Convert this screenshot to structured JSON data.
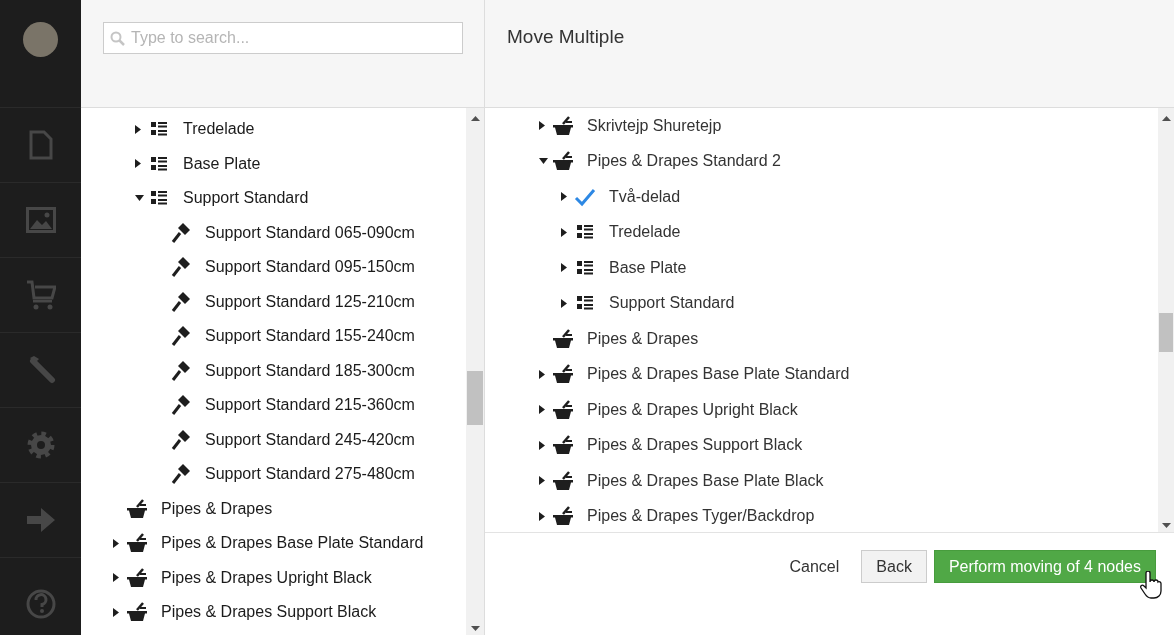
{
  "search": {
    "placeholder": "Type to search..."
  },
  "left_tree": {
    "items": [
      {
        "children": [
          {
            "label": "Tredelade",
            "kind": "list",
            "expanded": false
          },
          {
            "label": "Base Plate",
            "kind": "list",
            "expanded": false
          },
          {
            "label": "Support Standard",
            "kind": "list",
            "expanded": true,
            "children": [
              {
                "label": "Support Standard 065-090cm",
                "kind": "tool"
              },
              {
                "label": "Support Standard 095-150cm",
                "kind": "tool"
              },
              {
                "label": "Support Standard 125-210cm",
                "kind": "tool"
              },
              {
                "label": "Support Standard 155-240cm",
                "kind": "tool"
              },
              {
                "label": "Support Standard 185-300cm",
                "kind": "tool"
              },
              {
                "label": "Support Standard 215-360cm",
                "kind": "tool"
              },
              {
                "label": "Support Standard 245-420cm",
                "kind": "tool"
              },
              {
                "label": "Support Standard 275-480cm",
                "kind": "tool"
              }
            ]
          }
        ]
      },
      {
        "label": "Pipes & Drapes",
        "kind": "basket"
      },
      {
        "label": "Pipes & Drapes Base Plate Standard",
        "kind": "basket",
        "expanded": false
      },
      {
        "label": "Pipes & Drapes Upright Black",
        "kind": "basket",
        "expanded": false
      },
      {
        "label": "Pipes & Drapes Support Black",
        "kind": "basket",
        "expanded": false
      }
    ]
  },
  "dialog": {
    "title": "Move Multiple",
    "tree": {
      "items": [
        {
          "label": "Skrivtejp Shuretejp",
          "kind": "basket",
          "expanded": false,
          "selected": false
        },
        {
          "label": "Pipes & Drapes Standard 2",
          "kind": "basket",
          "expanded": true,
          "selected": false,
          "children": [
            {
              "label": "Två-delad",
              "kind": "list",
              "expanded": false,
              "selected": true
            },
            {
              "label": "Tredelade",
              "kind": "list",
              "expanded": false,
              "selected": false
            },
            {
              "label": "Base Plate",
              "kind": "list",
              "expanded": false,
              "selected": false
            },
            {
              "label": "Support Standard",
              "kind": "list",
              "expanded": false,
              "selected": false
            }
          ]
        },
        {
          "label": "Pipes & Drapes",
          "kind": "basket",
          "selected": false
        },
        {
          "label": "Pipes & Drapes Base Plate Standard",
          "kind": "basket",
          "expanded": false,
          "selected": false
        },
        {
          "label": "Pipes & Drapes Upright Black",
          "kind": "basket",
          "expanded": false,
          "selected": false
        },
        {
          "label": "Pipes & Drapes Support Black",
          "kind": "basket",
          "expanded": false,
          "selected": false
        },
        {
          "label": "Pipes & Drapes Base Plate Black",
          "kind": "basket",
          "expanded": false,
          "selected": false
        },
        {
          "label": "Pipes & Drapes Tyger/Backdrop",
          "kind": "basket",
          "expanded": false,
          "selected": false
        }
      ]
    },
    "buttons": [
      {
        "label": "Cancel",
        "kind": "link"
      },
      {
        "label": "Back",
        "kind": "default"
      },
      {
        "label": "Perform moving of 4 nodes",
        "kind": "primary"
      }
    ]
  }
}
